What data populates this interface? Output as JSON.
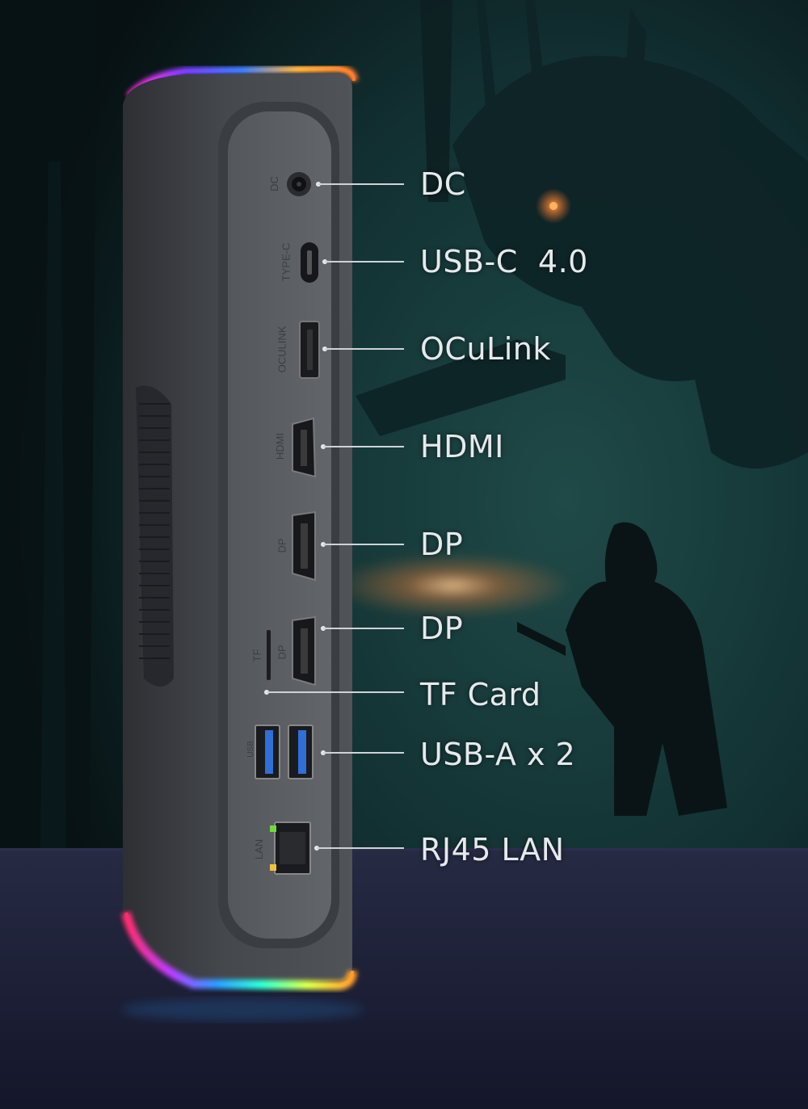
{
  "callouts": [
    {
      "id": "dc",
      "label": "DC"
    },
    {
      "id": "usbc",
      "label": "USB-C  4.0"
    },
    {
      "id": "oculink",
      "label": "OCuLink"
    },
    {
      "id": "hdmi",
      "label": "HDMI"
    },
    {
      "id": "dp1",
      "label": "DP"
    },
    {
      "id": "dp2",
      "label": "DP"
    },
    {
      "id": "tf",
      "label": "TF Card"
    },
    {
      "id": "usba",
      "label": "USB-A x 2"
    },
    {
      "id": "lan",
      "label": "RJ45 LAN"
    }
  ],
  "port_labels": {
    "dc": "DC",
    "typec": "TYPE-C",
    "oculink": "OCULINK",
    "hdmi": "HDMI",
    "dp1": "DP",
    "dp2": "DP",
    "tf": "TF",
    "usb": "USB",
    "lan": "LAN"
  },
  "colors": {
    "accent_usb_blue": "#2f6fd6",
    "rgb_glow": [
      "#ff2bd6",
      "#7a3cff",
      "#2b9bff",
      "#2bffd1",
      "#ffe14a",
      "#ff7a2b"
    ],
    "background": "#0b1518",
    "floor": "#1f2236",
    "device_body": "#4a4d52",
    "device_panel": "#5b5e63"
  }
}
